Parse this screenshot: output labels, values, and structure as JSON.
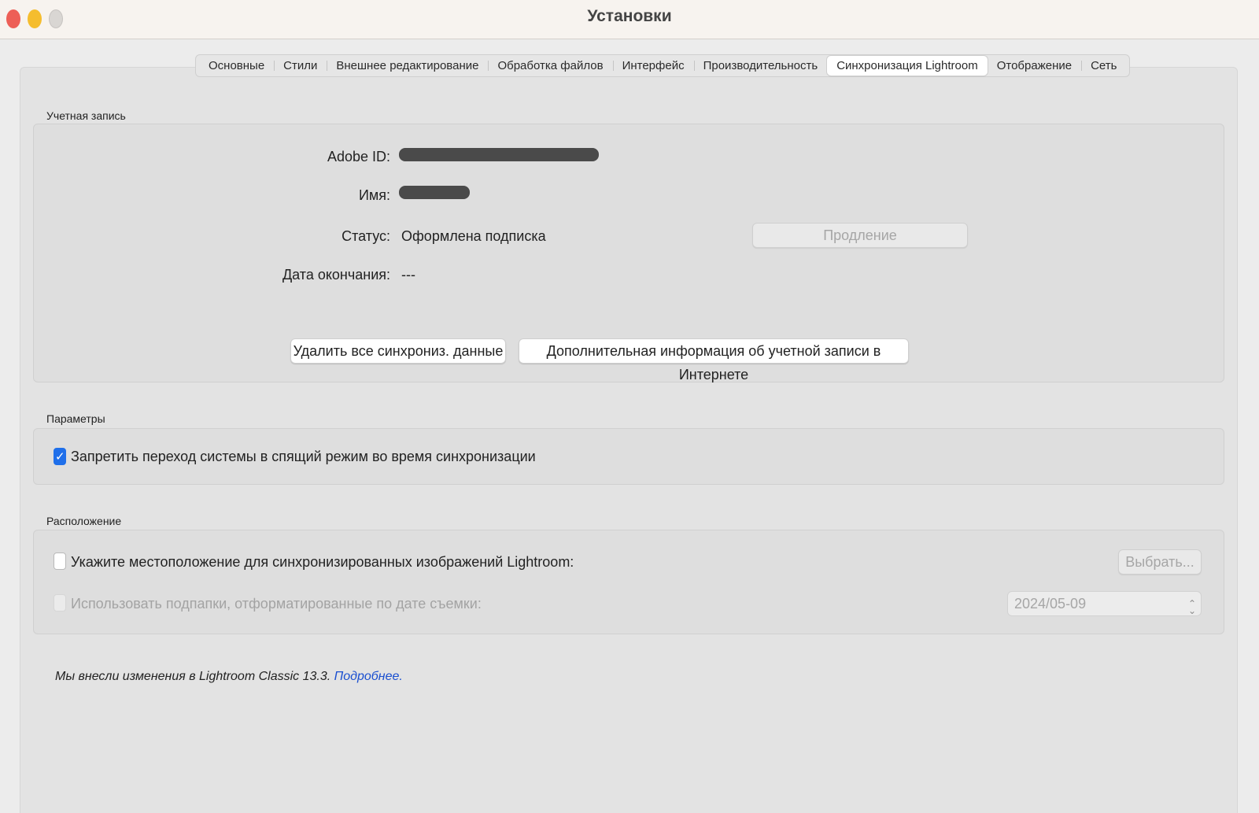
{
  "window": {
    "title": "Установки"
  },
  "tabs": [
    {
      "label": "Основные"
    },
    {
      "label": "Стили"
    },
    {
      "label": "Внешнее редактирование"
    },
    {
      "label": "Обработка файлов"
    },
    {
      "label": "Интерфейс"
    },
    {
      "label": "Производительность"
    },
    {
      "label": "Синхронизация Lightroom",
      "active": true
    },
    {
      "label": "Отображение"
    },
    {
      "label": "Сеть"
    }
  ],
  "account": {
    "group_label": "Учетная запись",
    "adobe_id_label": "Adobe ID:",
    "name_label": "Имя:",
    "status_label": "Статус:",
    "status_value": "Оформлена подписка",
    "renew_button": "Продление",
    "expiry_label": "Дата окончания:",
    "expiry_value": "---",
    "delete_button": "Удалить все синхрониз. данные",
    "info_button": "Дополнительная информация об учетной записи в Интернете"
  },
  "params": {
    "group_label": "Параметры",
    "prevent_sleep_label": "Запретить переход системы в спящий режим во время синхронизации",
    "prevent_sleep_checked": true
  },
  "location": {
    "group_label": "Расположение",
    "specify_label": "Укажите местоположение для синхронизированных изображений Lightroom:",
    "specify_checked": false,
    "choose_button": "Выбрать...",
    "subfolders_label": "Использовать подпапки, отформатированные по дате съемки:",
    "subfolders_checked": false,
    "date_format_value": "2024/05-09"
  },
  "footer": {
    "note_text": "Мы внесли изменения в Lightroom Classic 13.3.",
    "more_link": "Подробнее."
  },
  "colors": {
    "accent": "#1f6fea",
    "link": "#1a4fd0"
  }
}
